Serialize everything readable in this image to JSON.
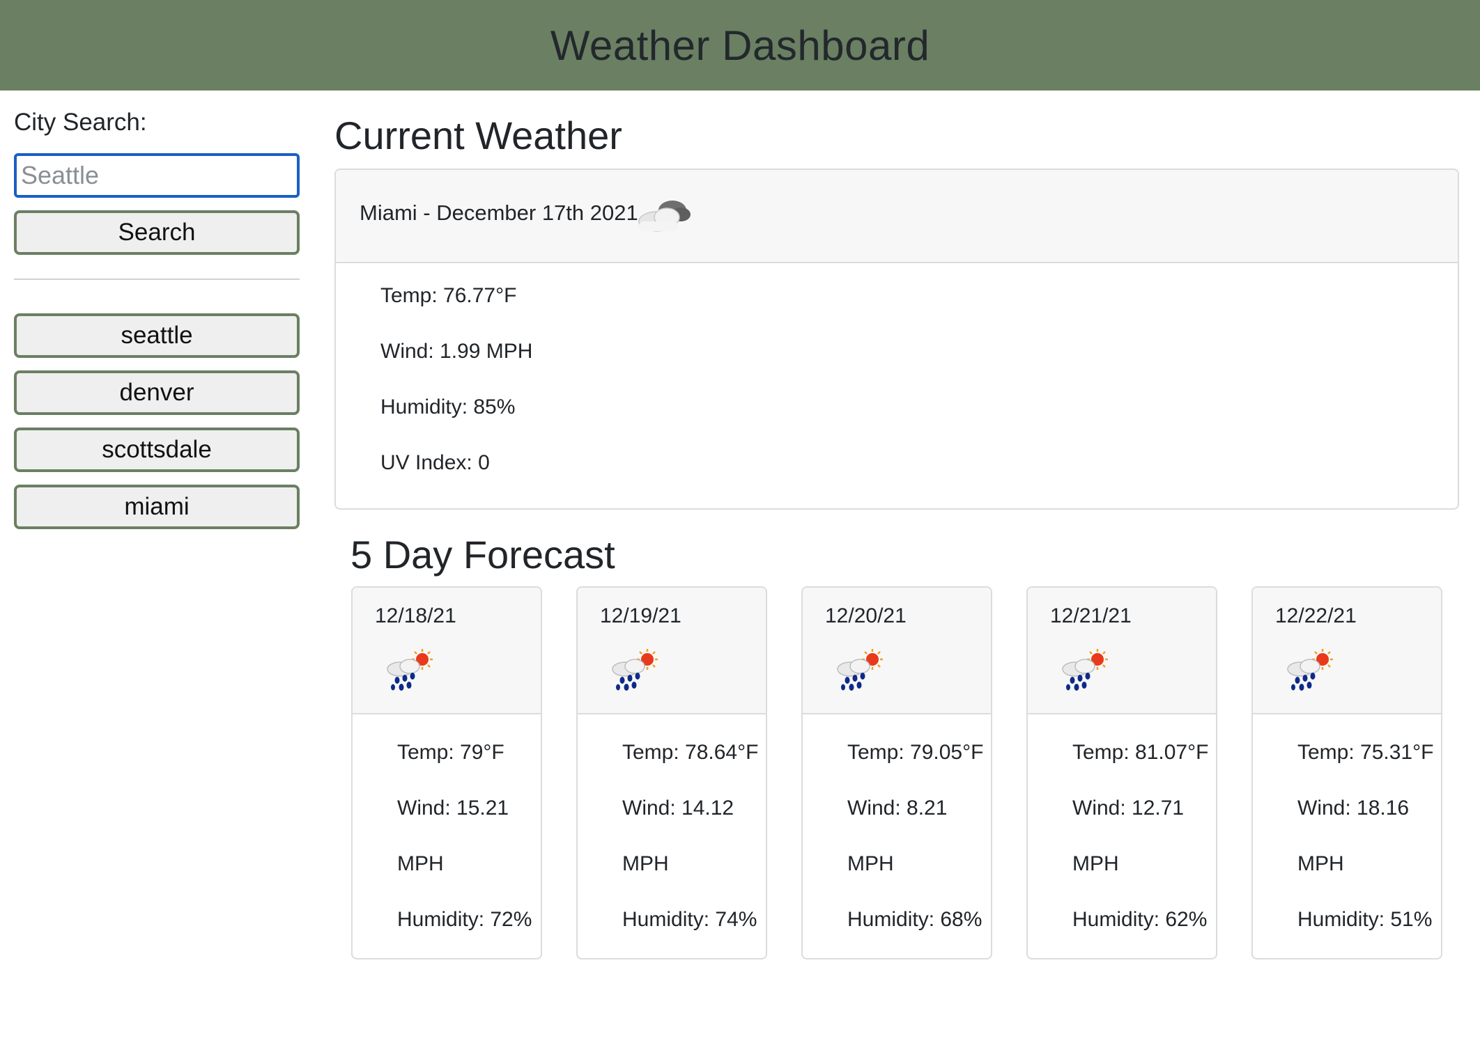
{
  "header": {
    "title": "Weather Dashboard"
  },
  "sidebar": {
    "search_label": "City Search:",
    "search_placeholder": "Seattle",
    "search_button": "Search",
    "history": [
      "seattle",
      "denver",
      "scottsdale",
      "miami"
    ]
  },
  "current": {
    "section_title": "Current Weather",
    "title": "Miami - December 17th 2021",
    "icon": "cloudy-icon",
    "temp": "Temp: 76.77°F",
    "wind": "Wind: 1.99 MPH",
    "humidity": "Humidity: 85%",
    "uv": "UV Index: 0"
  },
  "forecast": {
    "section_title": "5 Day Forecast",
    "days": [
      {
        "date": "12/18/21",
        "icon": "rain-sun-icon",
        "temp": "Temp: 79°F",
        "wind": "Wind: 15.21",
        "wind_unit": "MPH",
        "humidity": "Humidity: 72%"
      },
      {
        "date": "12/19/21",
        "icon": "rain-sun-icon",
        "temp": "Temp: 78.64°F",
        "wind": "Wind: 14.12",
        "wind_unit": "MPH",
        "humidity": "Humidity: 74%"
      },
      {
        "date": "12/20/21",
        "icon": "rain-sun-icon",
        "temp": "Temp: 79.05°F",
        "wind": "Wind: 8.21",
        "wind_unit": "MPH",
        "humidity": "Humidity: 68%"
      },
      {
        "date": "12/21/21",
        "icon": "rain-sun-icon",
        "temp": "Temp: 81.07°F",
        "wind": "Wind: 12.71",
        "wind_unit": "MPH",
        "humidity": "Humidity: 62%"
      },
      {
        "date": "12/22/21",
        "icon": "rain-sun-icon",
        "temp": "Temp: 75.31°F",
        "wind": "Wind: 18.16",
        "wind_unit": "MPH",
        "humidity": "Humidity: 51%"
      }
    ]
  },
  "colors": {
    "header_bg": "#6b7f63",
    "button_border": "#6b7f63",
    "input_focus": "#1a5fc4"
  }
}
